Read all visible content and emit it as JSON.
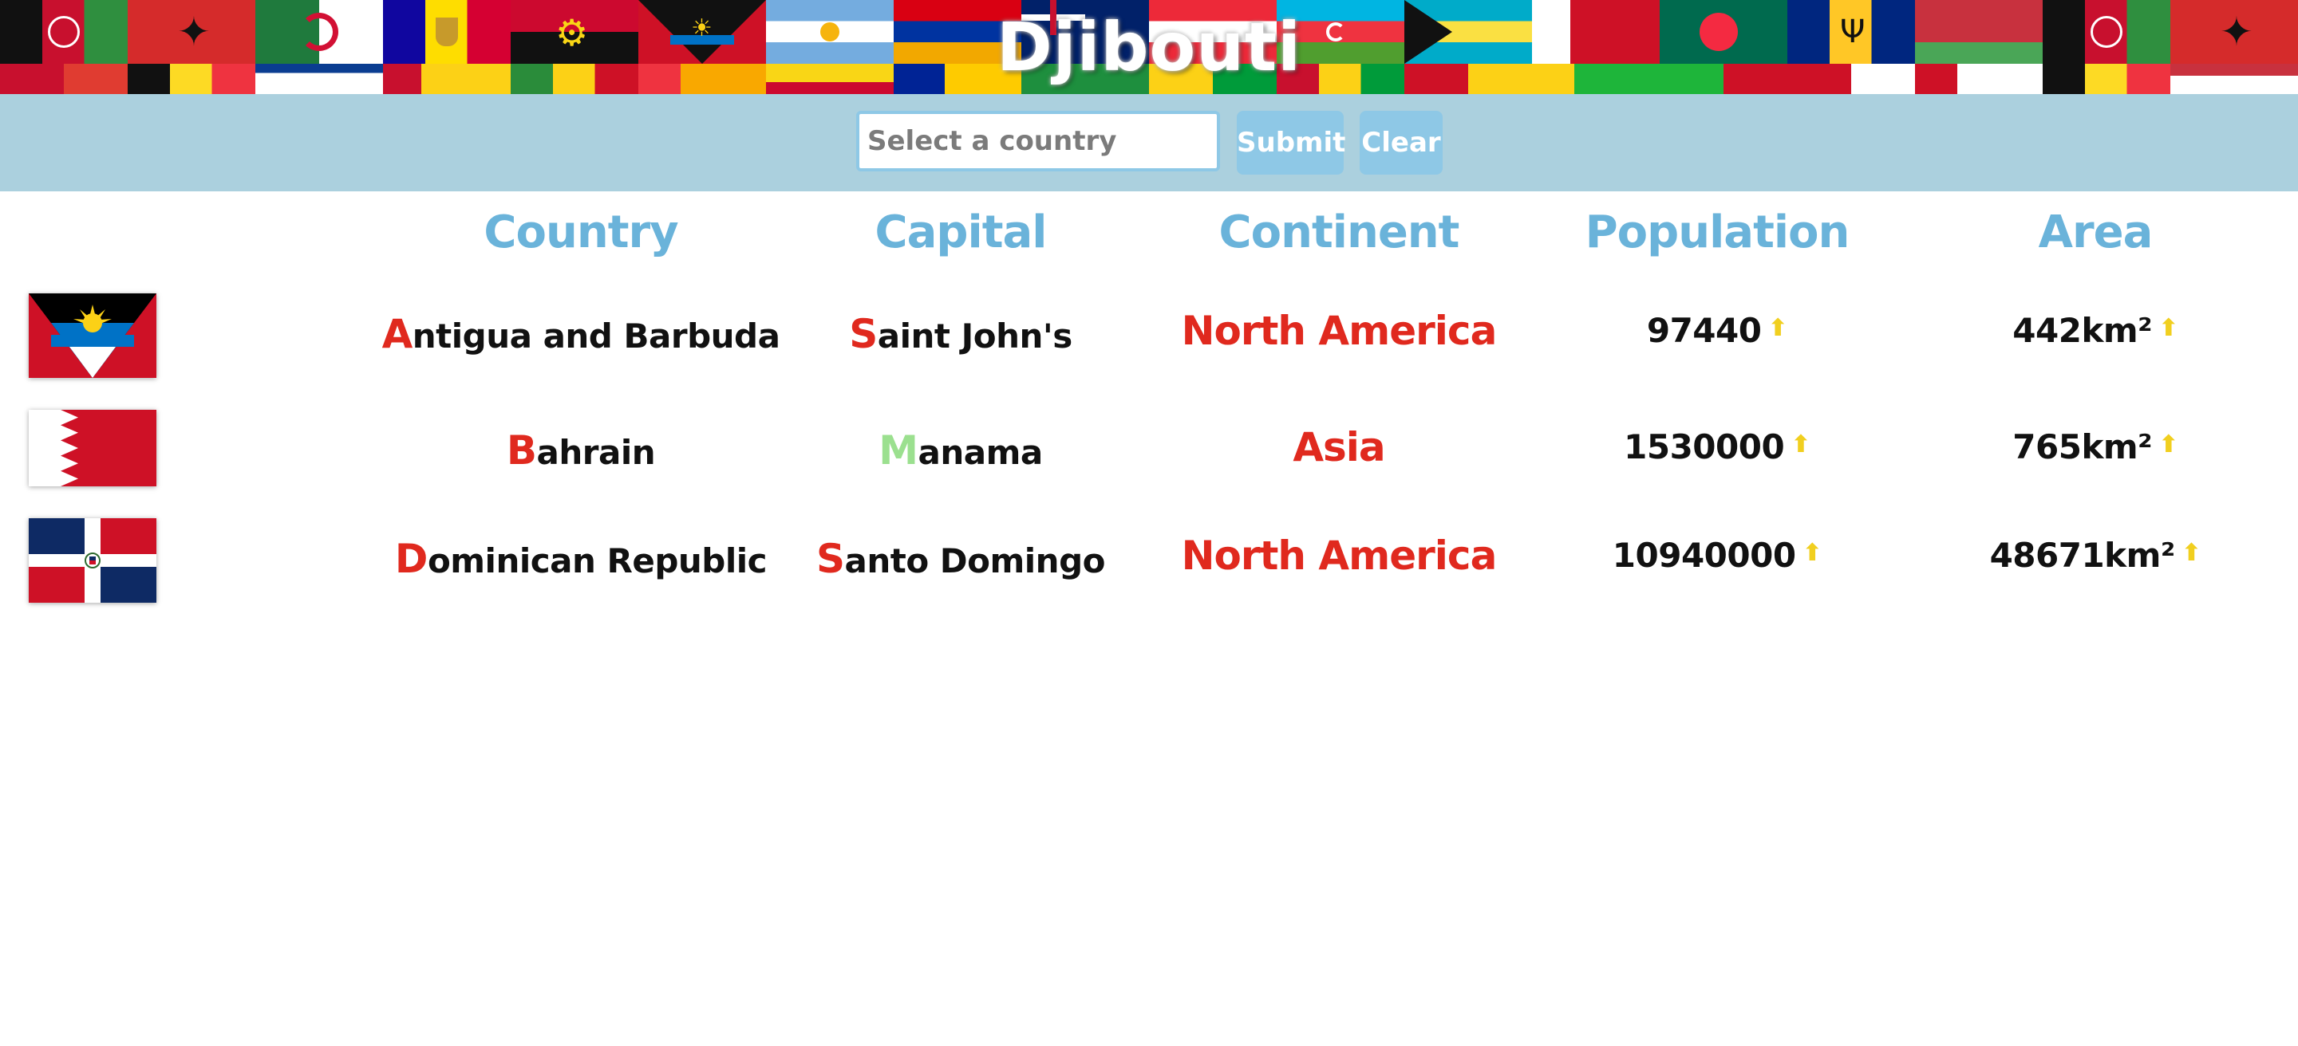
{
  "title": "Djibouti",
  "search": {
    "placeholder": "Select a country",
    "value": ""
  },
  "buttons": {
    "submit": "Submit",
    "clear": "Clear"
  },
  "headers": [
    "Country",
    "Capital",
    "Continent",
    "Population",
    "Area"
  ],
  "rows": [
    {
      "flag": "antigua-and-barbuda-flag",
      "country_first": "A",
      "country_rest": "ntigua and Barbuda",
      "capital_first": "S",
      "capital_rest": "aint John's",
      "continent": "North America",
      "population": "97440",
      "area": "442km²",
      "hint": "up-arrow"
    },
    {
      "flag": "bahrain-flag",
      "country_first": "B",
      "country_rest": "ahrain",
      "capital_first": "M",
      "capital_rest": "anama",
      "continent": "Asia",
      "population": "1530000",
      "area": "765km²",
      "hint": "up-arrow"
    },
    {
      "flag": "dominican-republic-flag",
      "country_first": "D",
      "country_rest": "ominican Republic",
      "capital_first": "S",
      "capital_rest": "anto Domingo",
      "continent": "North America",
      "population": "10940000",
      "area": "48671km²",
      "hint": "up-arrow"
    }
  ],
  "colors": {
    "header_text": "#6ab3da",
    "control_bar": "#abd0de",
    "button": "#8ec8e6",
    "incorrect": "#e0291e",
    "correct": "#9be08f",
    "hint_arrow": "#f1cf1f"
  },
  "arrow_glyph": "⬆"
}
